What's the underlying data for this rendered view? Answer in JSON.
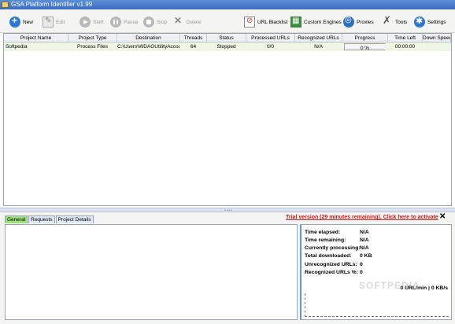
{
  "window": {
    "title": "GSA Platform Identifier v1.99"
  },
  "toolbar": {
    "new": "New",
    "edit": "Edit",
    "start": "Start",
    "pause": "Pause",
    "stop": "Stop",
    "delete": "Delete",
    "blacklist": "URL Blacklist",
    "engines": "Custom Engines",
    "proxies": "Proxies",
    "tools": "Tools",
    "settings": "Settings"
  },
  "grid": {
    "columns": [
      "Project Name",
      "Project Type",
      "Destination",
      "Threads",
      "Status",
      "Processed URLs",
      "Recognized URLs",
      "Progress",
      "Time Left",
      "Down Speed"
    ],
    "rows": [
      {
        "name": "Softpedia",
        "type": "Process Files",
        "destination": "C:\\Users\\WDAGUtilityAccou",
        "threads": "64",
        "status": "Stopped",
        "processed": "0/0",
        "recognized": "N/A",
        "progress": "0 %",
        "time_left": "00:00:00",
        "down_speed": ""
      }
    ]
  },
  "bottom": {
    "tabs": [
      "General",
      "Requests",
      "Project Details"
    ],
    "trial": "Trial version (29 minutes remaining). Click here to activate",
    "close": "✕",
    "stats": [
      {
        "label": "Time elapsed:",
        "value": "N/A"
      },
      {
        "label": "Time remaining:",
        "value": "N/A"
      },
      {
        "label": "Currently processing:",
        "value": "N/A"
      },
      {
        "label": "Total downloaded:",
        "value": "0 KB"
      },
      {
        "label": "Unrecognized URLs:",
        "value": "0"
      },
      {
        "label": "Recognized URLs %:",
        "value": "0"
      }
    ],
    "rate": "0 URL/min | 0 KB/s"
  },
  "watermark": "SOFTPEDIA"
}
